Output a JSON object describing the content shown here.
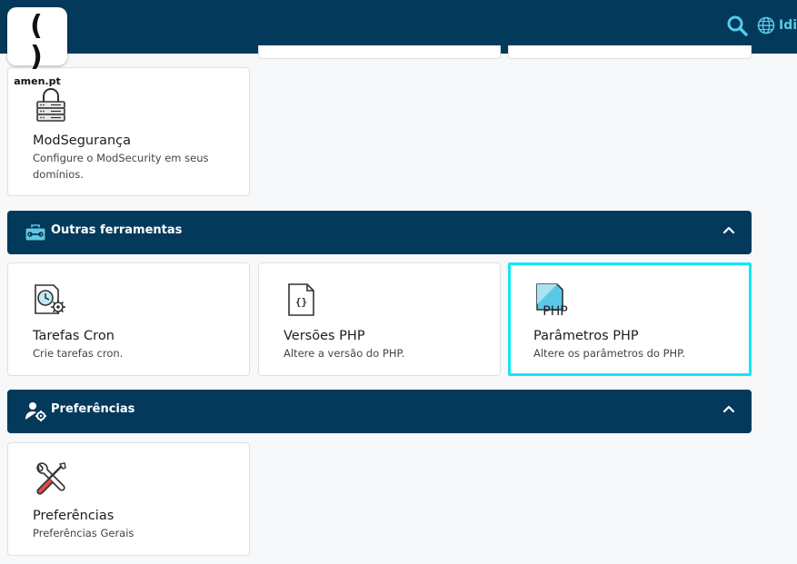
{
  "header": {
    "logo_symbol": "( )",
    "logo_text": "amen.pt",
    "language_label": "Idioma",
    "icons": [
      "search-icon",
      "globe-icon"
    ]
  },
  "cards_top": [
    {
      "title": "ModSegurança",
      "desc": "Configure o ModSecurity em seus domínios.",
      "icon": "lock-server-icon"
    }
  ],
  "sections": [
    {
      "title": "Outras ferramentas",
      "icon": "toolbox-icon",
      "cards": [
        {
          "title": "Tarefas Cron",
          "desc": "Crie tarefas cron.",
          "icon": "cron-clock-icon"
        },
        {
          "title": "Versões PHP",
          "desc": "Altere a versão do PHP.",
          "icon": "code-file-icon"
        },
        {
          "title": "Parâmetros PHP",
          "desc": "Altere os parâmetros do PHP.",
          "icon": "php-file-icon"
        }
      ]
    },
    {
      "title": "Preferências",
      "icon": "user-gear-icon",
      "cards": [
        {
          "title": "Preferências",
          "desc": "Preferências Gerais",
          "icon": "tools-icon"
        }
      ]
    }
  ],
  "colors": {
    "nav": "#033a5b",
    "accent": "#5bc8e8",
    "highlight": "#12e7f4",
    "background": "#f7f8fa"
  }
}
